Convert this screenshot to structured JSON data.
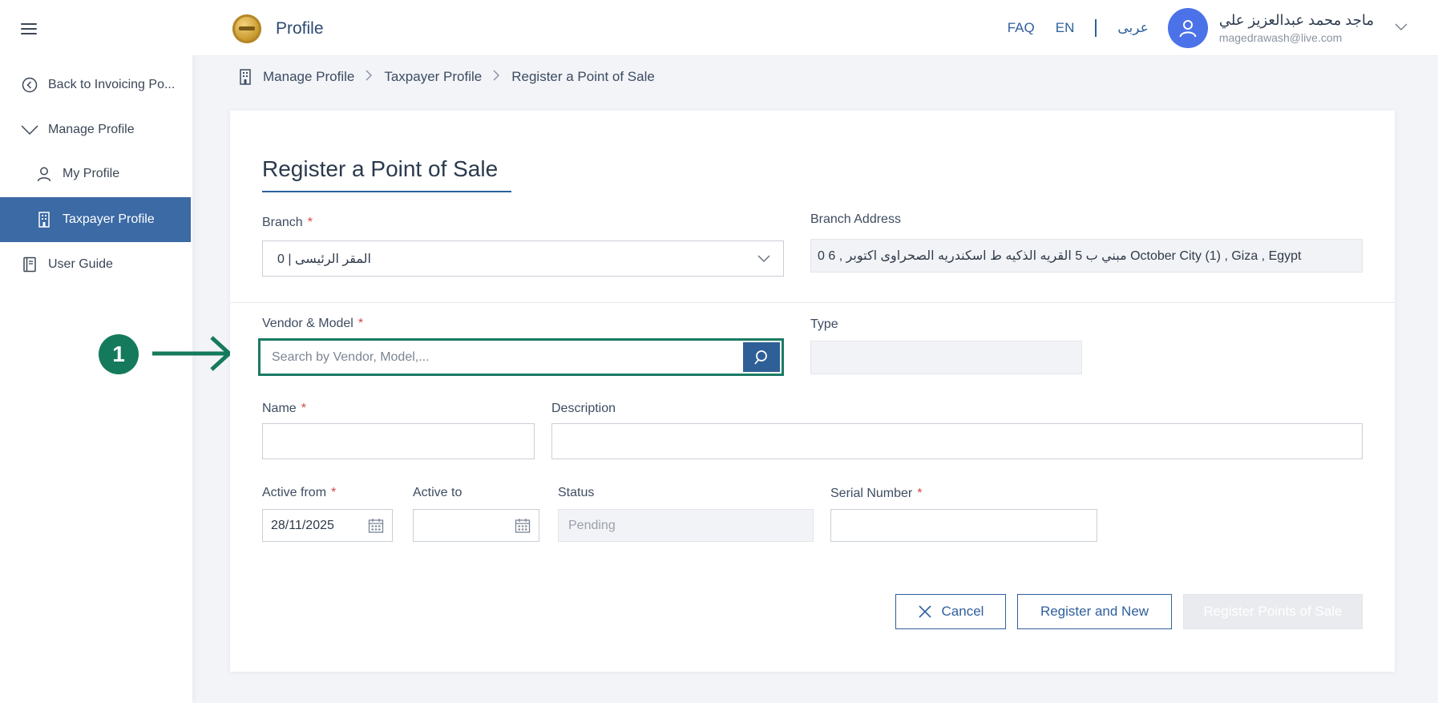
{
  "sidebar": {
    "items": [
      {
        "label": "Back to Invoicing Po...",
        "icon": "arrow-left-circle-icon"
      },
      {
        "label": "Manage Profile",
        "icon": "chevron-down-icon"
      },
      {
        "label": "My Profile",
        "icon": "user-icon"
      },
      {
        "label": "Taxpayer Profile",
        "icon": "building-icon"
      },
      {
        "label": "User Guide",
        "icon": "book-icon"
      }
    ]
  },
  "header": {
    "title": "Profile",
    "faq": "FAQ",
    "lang_en": "EN",
    "lang_ar": "عربى",
    "user_name": "ماجد محمد عبدالعزيز علي",
    "user_email": "magedrawash@live.com"
  },
  "breadcrumb": {
    "items": [
      "Manage Profile",
      "Taxpayer Profile",
      "Register a Point of Sale"
    ]
  },
  "form": {
    "title": "Register a Point of Sale",
    "branch_label": "Branch",
    "branch_value": "المقر الرئيسى | 0",
    "branch_address_label": "Branch Address",
    "branch_address_value": "0 6 , مبني ب 5 القريه الذكيه ط اسكندريه الصحراوى اكتوبر October City (1) , Giza , Egypt",
    "vendor_label": "Vendor & Model",
    "vendor_placeholder": "Search by Vendor, Model,...",
    "type_label": "Type",
    "name_label": "Name",
    "description_label": "Description",
    "active_from_label": "Active from",
    "active_from_value": "28/11/2025",
    "active_to_label": "Active to",
    "status_label": "Status",
    "status_value": "Pending",
    "serial_label": "Serial Number",
    "required_mark": "*"
  },
  "annotation": {
    "step_number": "1",
    "color": "#157a5c"
  },
  "buttons": {
    "cancel": "Cancel",
    "register_new": "Register and New",
    "register_pos": "Register Points of Sale"
  },
  "colors": {
    "primary": "#2e5f9c",
    "sidebar_active": "#3b6aa5",
    "avatar": "#4b72e8",
    "required": "#d64545",
    "highlight": "#1a7a63"
  }
}
